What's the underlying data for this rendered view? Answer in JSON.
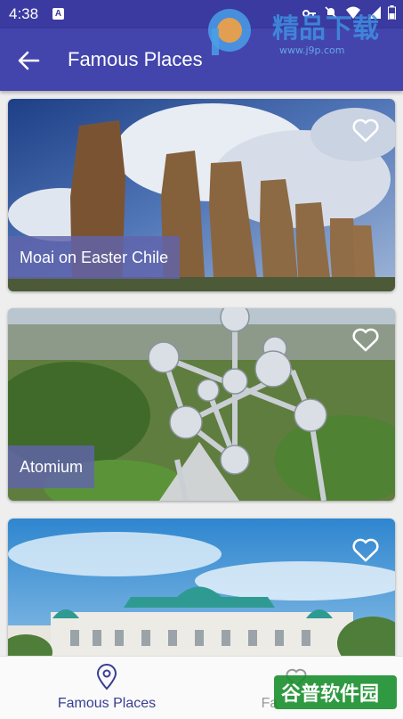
{
  "status_bar": {
    "time": "4:38",
    "badge": "A",
    "icons": [
      "key-icon",
      "mute-icon",
      "wifi-icon",
      "signal-icon",
      "battery-icon"
    ]
  },
  "app_bar": {
    "title": "Famous Places",
    "back_icon": "arrow-left-icon"
  },
  "places": [
    {
      "name": "Moai on Easter Chile",
      "favorite_icon": "heart-outline-icon"
    },
    {
      "name": "Atomium",
      "favorite_icon": "heart-outline-icon"
    },
    {
      "name": "",
      "favorite_icon": "heart-outline-icon"
    }
  ],
  "bottom_nav": {
    "items": [
      {
        "label": "Famous Places",
        "icon": "location-pin-icon",
        "active": true
      },
      {
        "label": "Fa",
        "icon": "heart-outline-icon",
        "active": false
      }
    ]
  },
  "watermarks": {
    "top_text": "精品下载",
    "top_url": "www.j9p.com",
    "bottom_text": "谷普软件园"
  },
  "colors": {
    "primary": "#4345ad",
    "status": "#3a3aa0",
    "label_bg": "#6064ac",
    "nav_active": "#3a3d93"
  }
}
